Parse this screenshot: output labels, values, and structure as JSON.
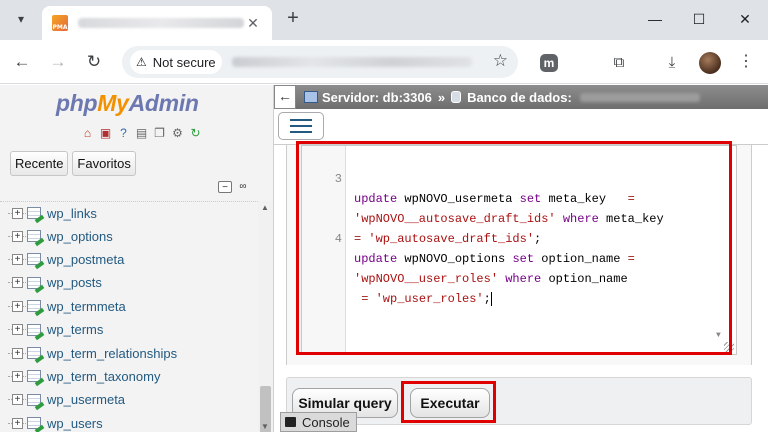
{
  "browser": {
    "tab": {
      "favicon_text": "PMA",
      "close_label": "✕"
    },
    "new_tab_label": "+",
    "window_controls": {
      "minimize": "—",
      "maximize": "☐",
      "close": "✕"
    },
    "nav": {
      "back": "←",
      "forward": "→",
      "reload": "↻"
    },
    "security_label": "Not secure",
    "extension_m": "m"
  },
  "pma": {
    "logo": {
      "php": "php",
      "my": "My",
      "admin": "Admin"
    },
    "nav_tabs": [
      "Recente",
      "Favoritos"
    ],
    "tables": [
      "wp_links",
      "wp_options",
      "wp_postmeta",
      "wp_posts",
      "wp_termmeta",
      "wp_terms",
      "wp_term_relationships",
      "wp_term_taxonomy",
      "wp_usermeta",
      "wp_users"
    ]
  },
  "breadcrumb": {
    "server": "Servidor: db:3306",
    "separator": "»",
    "database": "Banco de dados:"
  },
  "editor": {
    "lines": [
      {
        "num": "3",
        "segments": [
          {
            "t": "update",
            "c": "kw"
          },
          {
            "t": " wpNOVO_usermeta ",
            "c": "ident"
          },
          {
            "t": "set",
            "c": "kw"
          },
          {
            "t": " meta_key   ",
            "c": "ident"
          },
          {
            "t": "=",
            "c": "op"
          }
        ]
      },
      {
        "num": "",
        "segments": [
          {
            "t": "'wpNOVO__autosave_draft_ids'",
            "c": "str"
          },
          {
            "t": " ",
            "c": "ident"
          },
          {
            "t": "where",
            "c": "kw"
          },
          {
            "t": " meta_key",
            "c": "ident"
          }
        ]
      },
      {
        "num": "",
        "segments": [
          {
            "t": "=",
            "c": "op"
          },
          {
            "t": " ",
            "c": "ident"
          },
          {
            "t": "'wp_autosave_draft_ids'",
            "c": "str"
          },
          {
            "t": ";",
            "c": "ident"
          }
        ]
      },
      {
        "num": "4",
        "segments": [
          {
            "t": "update",
            "c": "kw"
          },
          {
            "t": " wpNOVO_options ",
            "c": "ident"
          },
          {
            "t": "set",
            "c": "kw"
          },
          {
            "t": " option_name ",
            "c": "ident"
          },
          {
            "t": "=",
            "c": "op"
          }
        ]
      },
      {
        "num": "",
        "segments": [
          {
            "t": "'wpNOVO__user_roles'",
            "c": "str"
          },
          {
            "t": " ",
            "c": "ident"
          },
          {
            "t": "where",
            "c": "kw"
          },
          {
            "t": " option_name",
            "c": "ident"
          }
        ]
      },
      {
        "num": "",
        "segments": [
          {
            "t": " ",
            "c": "ident"
          },
          {
            "t": "=",
            "c": "op"
          },
          {
            "t": " ",
            "c": "ident"
          },
          {
            "t": "'wp_user_roles'",
            "c": "str"
          },
          {
            "t": ";",
            "c": "ident"
          }
        ]
      }
    ]
  },
  "buttons": {
    "simulate": "Simular query",
    "execute": "Executar"
  },
  "console_label": "Console",
  "colors": {
    "highlight": "#e00000",
    "link": "#235a81",
    "logo_blue": "#6c78af",
    "logo_orange": "#f29100"
  }
}
